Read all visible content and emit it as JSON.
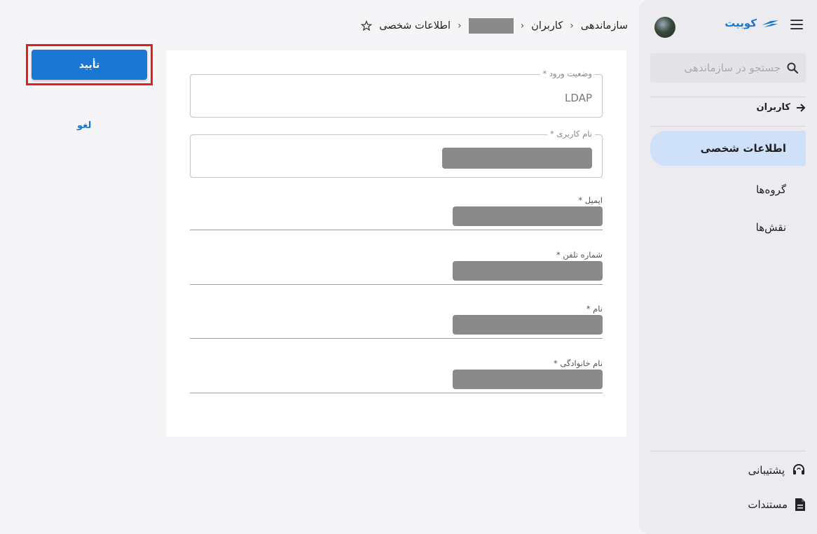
{
  "sidebar": {
    "brand_name": "کوبیت",
    "search_placeholder": "جستجو در سازماندهی",
    "back_label": "کاربران",
    "items": [
      {
        "label": "اطلاعات شخصی",
        "active": true
      },
      {
        "label": "گروه‌ها",
        "active": false
      },
      {
        "label": "نقش‌ها",
        "active": false
      }
    ],
    "support_label": "پشتیبانی",
    "docs_label": "مستندات"
  },
  "breadcrumb": {
    "root": "سازماندهی",
    "users": "کاربران",
    "current": "اطلاعات شخصی"
  },
  "form": {
    "login_status_label": "وضعیت ورود *",
    "login_status_value": "LDAP",
    "username_label": "نام کاربری *",
    "email_label": "ایمیل *",
    "phone_label": "شماره تلفن *",
    "first_name_label": "نام *",
    "last_name_label": "نام خانوادگی *"
  },
  "actions": {
    "confirm_label": "تأیید",
    "cancel_label": "لغو"
  },
  "colors": {
    "accent": "#1976d2",
    "active_nav_bg": "#cfe0f9",
    "highlight_border": "#e02020",
    "redaction": "#8a8a8a"
  },
  "icons": [
    "menu-icon",
    "brand-logo-icon",
    "search-icon",
    "arrow-right-icon",
    "headset-icon",
    "document-icon",
    "star-icon",
    "chevron-left-icon"
  ]
}
